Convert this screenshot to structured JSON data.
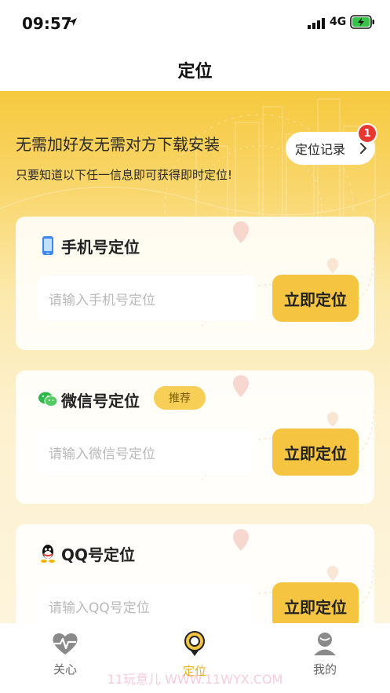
{
  "status": {
    "time": "09:57",
    "network": "4G"
  },
  "nav": {
    "title": "定位"
  },
  "hero": {
    "line1": "无需加好友无需对方下载安装",
    "line2": "只要知道以下任一信息即可获得即时定位!",
    "record_label": "定位记录",
    "record_badge": "1"
  },
  "cards": [
    {
      "title": "手机号定位",
      "placeholder": "请输入手机号定位",
      "button": "立即定位",
      "icon": "phone-icon"
    },
    {
      "title": "微信号定位",
      "tag": "推荐",
      "placeholder": "请输入微信号定位",
      "button": "立即定位",
      "icon": "wechat-icon"
    },
    {
      "title": "QQ号定位",
      "placeholder": "请输入QQ号定位",
      "button": "立即定位",
      "icon": "qq-icon"
    }
  ],
  "tabs": [
    {
      "label": "关心",
      "icon": "heart-pulse-icon"
    },
    {
      "label": "定位",
      "icon": "location-pin-icon",
      "active": true
    },
    {
      "label": "我的",
      "icon": "user-icon"
    }
  ],
  "watermark": "11玩意儿 WWW.11WYX.COM",
  "colors": {
    "accent": "#f5c542",
    "badge": "#e8382f",
    "active_tab": "#e9ad18"
  }
}
